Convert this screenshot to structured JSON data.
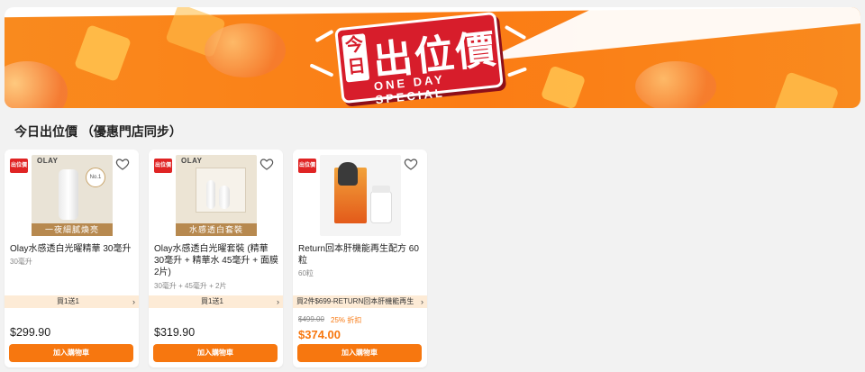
{
  "banner": {
    "sign_tag": "今日",
    "sign_title": "出位價",
    "sign_subtitle": "ONE DAY SPECIAL"
  },
  "section": {
    "title": "今日出位價 （優惠門店同步）"
  },
  "badge_text": "出位價",
  "products": [
    {
      "image_brand": "OLAY",
      "image_caption": "一夜細膩煥亮",
      "image_tag": "No.1",
      "name": "Olay水感透白光曜精華 30毫升",
      "spec": "30毫升",
      "promo": "買1送1",
      "price": "$299.90",
      "button": "加入購物車"
    },
    {
      "image_brand": "OLAY",
      "image_caption": "水感透白套裝",
      "name": "Olay水感透白光曜套裝 (精華 30毫升 + 精華水 45毫升 + 面膜 2片)",
      "spec": "30毫升 + 45毫升 + 2片",
      "promo": "買1送1",
      "price": "$319.90",
      "button": "加入購物車"
    },
    {
      "name": "Return回本肝機能再生配方 60粒",
      "spec": "60粒",
      "promo": "買2件$699-RETURN回本肝機能再生",
      "original_price": "$499.00",
      "discount": "25% 折扣",
      "price": "$374.00",
      "button": "加入購物車"
    }
  ],
  "colors": {
    "accent": "#f7770f",
    "banner_red": "#d71d2b",
    "promo_bg": "#fdebd6"
  }
}
